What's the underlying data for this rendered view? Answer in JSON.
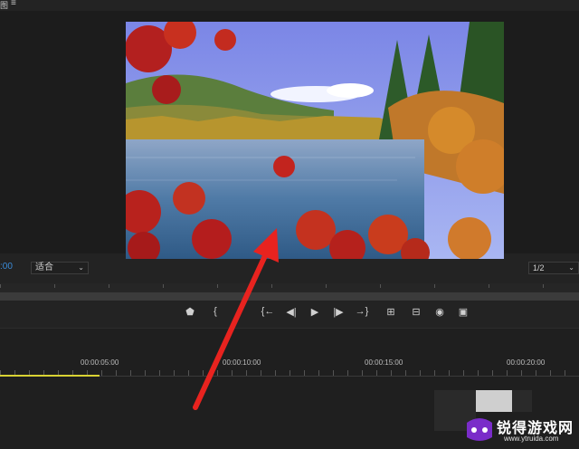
{
  "topbar": {
    "title": "图",
    "menu_icon": "≡"
  },
  "monitor": {
    "scene": "autumn-lake-landscape"
  },
  "controls": {
    "timecode": ":00",
    "fit_select": "适合",
    "resolution_select": "1/2"
  },
  "transport": {
    "buttons": [
      {
        "name": "marker-icon",
        "glyph": "⬟"
      },
      {
        "name": "mark-in-icon",
        "glyph": "{"
      },
      {
        "name": "go-to-in-icon",
        "glyph": "{←"
      },
      {
        "name": "step-back-icon",
        "glyph": "◀|"
      },
      {
        "name": "play-icon",
        "glyph": "▶"
      },
      {
        "name": "step-forward-icon",
        "glyph": "|▶"
      },
      {
        "name": "go-to-out-icon",
        "glyph": "→}"
      },
      {
        "name": "insert-icon",
        "glyph": "⊞"
      },
      {
        "name": "overwrite-icon",
        "glyph": "⊟"
      },
      {
        "name": "camera-icon",
        "glyph": "◉"
      },
      {
        "name": "compare-icon",
        "glyph": "▣"
      }
    ]
  },
  "timeline": {
    "labels": [
      "00:00:05:00",
      "00:00:10:00",
      "00:00:15:00",
      "00:00:20:00"
    ]
  },
  "watermark": {
    "name": "锐得游戏网",
    "url": "www.ytruida.com"
  },
  "colors": {
    "accent": "#3a8ad7",
    "playhead": "#d9d233",
    "arrow": "#e8231f"
  }
}
